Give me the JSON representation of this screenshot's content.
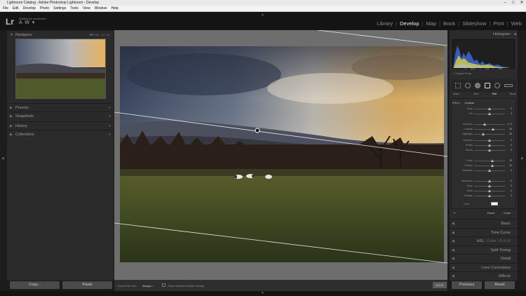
{
  "window": {
    "title": "Lightroom Catalog - Adobe Photoshop Lightroom - Develop",
    "controls": [
      "–",
      "□",
      "✕"
    ]
  },
  "menu": [
    "File",
    "Edit",
    "Develop",
    "Photo",
    "Settings",
    "Tools",
    "View",
    "Window",
    "Help"
  ],
  "identity": {
    "logo": "Lr",
    "status": "Waiting for connection",
    "name": "A W"
  },
  "modules": {
    "items": [
      "Library",
      "Develop",
      "Map",
      "Book",
      "Slideshow",
      "Print",
      "Web"
    ],
    "active": "Develop"
  },
  "left_panel": {
    "navigator": {
      "label": "Navigator",
      "zoom": [
        "FIT",
        "FILL",
        "1:1",
        "1:4"
      ]
    },
    "sections": [
      {
        "label": "Presets"
      },
      {
        "label": "Snapshots"
      },
      {
        "label": "History"
      },
      {
        "label": "Collections"
      }
    ],
    "copy_label": "Copy...",
    "paste_label": "Paste"
  },
  "right_panel": {
    "histogram_label": "Histogram",
    "readout": [
      "L",
      "30.2",
      "/",
      "-1.8",
      "/",
      "-9.5"
    ],
    "original_photo": "Original Photo",
    "brush_modes": [
      "Mask :",
      "New",
      "Edit",
      "Brush"
    ],
    "effect_label": "Effect :",
    "effect_value": "Custom",
    "sliders": [
      {
        "name": "Temp",
        "value": "0",
        "pos": 0.5
      },
      {
        "name": "Tint",
        "value": "0",
        "pos": 0.5
      },
      {
        "name": "Exposure",
        "value": "-1.71",
        "pos": 0.33
      },
      {
        "name": "Contrast",
        "value": "30",
        "pos": 0.62
      },
      {
        "name": "Highlights",
        "value": "-43",
        "pos": 0.3
      },
      {
        "name": "Shadows",
        "value": "0",
        "pos": 0.5
      },
      {
        "name": "Whites",
        "value": "0",
        "pos": 0.5
      },
      {
        "name": "Blacks",
        "value": "0",
        "pos": 0.5
      },
      {
        "name": "Clarity",
        "value": "29",
        "pos": 0.6
      },
      {
        "name": "Dehaze",
        "value": "29",
        "pos": 0.6
      },
      {
        "name": "Saturation",
        "value": "0",
        "pos": 0.5
      },
      {
        "name": "Sharpness",
        "value": "0",
        "pos": 0.5
      },
      {
        "name": "Noise",
        "value": "0",
        "pos": 0.5
      },
      {
        "name": "Moiré",
        "value": "0",
        "pos": 0.5
      },
      {
        "name": "Defringe",
        "value": "0",
        "pos": 0.5
      }
    ],
    "color_label": "Color",
    "reset_label": "Reset",
    "close_label": "Close",
    "sections": [
      {
        "label": "Basic"
      },
      {
        "label": "Tone Curve"
      },
      {
        "label": "HSL",
        "extra": "/ Color / B & W"
      },
      {
        "label": "Split Toning"
      },
      {
        "label": "Detail"
      },
      {
        "label": "Lens Corrections"
      },
      {
        "label": "Effects"
      }
    ],
    "previous_label": "Previous",
    "reset_button_label": "Reset"
  },
  "toolbar": {
    "show_edit_pins_label": "Show Edit Pins :",
    "show_edit_pins_value": "Always ÷",
    "show_mask_label": "Show Selected Mask Overlay",
    "done_label": "Done"
  },
  "colors": {
    "accent_active": "#eeeeee",
    "panel_bg": "#2b2b2b",
    "background": "#1b1b1b"
  }
}
